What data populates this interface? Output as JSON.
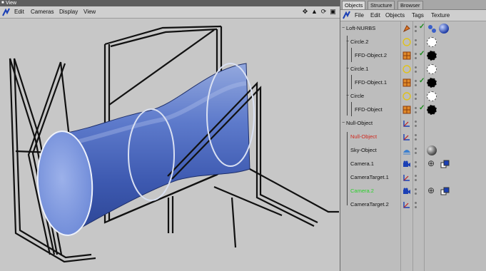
{
  "viewport": {
    "title": "View",
    "menu": [
      "Edit",
      "Cameras",
      "Display",
      "View"
    ]
  },
  "panel": {
    "tabs": [
      "Objects",
      "Structure",
      "Browser"
    ],
    "menu": [
      "File",
      "Edit",
      "Objects",
      "Tags",
      "Texture"
    ],
    "objects": [
      {
        "name": "Loft-NURBS",
        "color": "#111111"
      },
      {
        "name": "Circle.2",
        "color": "#111111"
      },
      {
        "name": "FFD-Object.2",
        "color": "#111111"
      },
      {
        "name": "Circle.1",
        "color": "#111111"
      },
      {
        "name": "FFD-Object.1",
        "color": "#111111"
      },
      {
        "name": "Circle",
        "color": "#111111"
      },
      {
        "name": "FFD-Object",
        "color": "#111111"
      },
      {
        "name": "Null-Object",
        "color": "#111111"
      },
      {
        "name": "Null-Object",
        "color": "#d0281e"
      },
      {
        "name": "Sky-Object",
        "color": "#111111"
      },
      {
        "name": "Camera.1",
        "color": "#111111"
      },
      {
        "name": "CameraTarget.1",
        "color": "#111111"
      },
      {
        "name": "Camera.2",
        "color": "#2bd12b"
      },
      {
        "name": "CameraTarget.2",
        "color": "#111111"
      }
    ]
  }
}
